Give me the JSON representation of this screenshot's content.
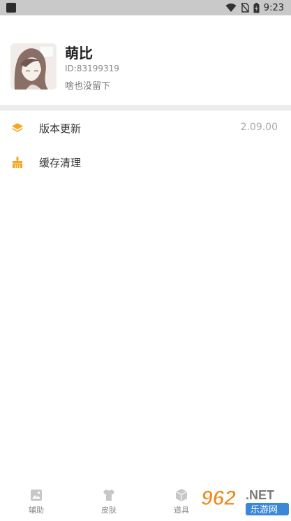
{
  "status_bar": {
    "time": "9:23"
  },
  "profile": {
    "name": "萌比",
    "id_text": "ID:83199319",
    "signature": "啥也没留下"
  },
  "menu": [
    {
      "icon": "layers-icon",
      "label": "版本更新",
      "value": "2.09.00"
    },
    {
      "icon": "brush-icon",
      "label": "缓存清理",
      "value": ""
    }
  ],
  "tabs": [
    {
      "icon": "image-icon",
      "label": "辅助"
    },
    {
      "icon": "shirt-icon",
      "label": "皮肤"
    },
    {
      "icon": "cube-icon",
      "label": "道具"
    }
  ],
  "watermark": {
    "number": "962",
    "net": ".NET",
    "name": "乐游网"
  },
  "colors": {
    "accent": "#f5a623",
    "status_bar": "#c9c9c9",
    "divider": "#ececec"
  }
}
